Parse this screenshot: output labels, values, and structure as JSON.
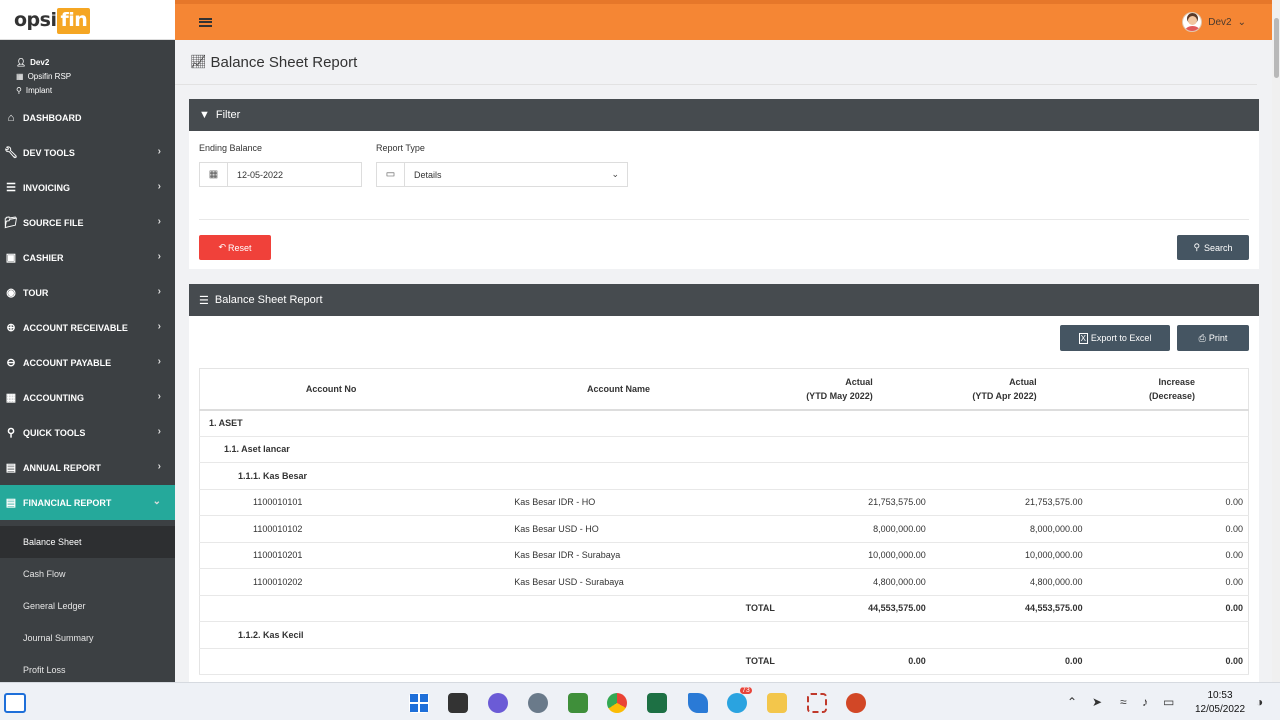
{
  "brand": {
    "logo_a": "opsi",
    "logo_b": "fin"
  },
  "header": {
    "user": "Dev2"
  },
  "user_info": {
    "name": "Dev2",
    "company": "Opsifin RSP",
    "location": "Implant"
  },
  "sidebar": {
    "items": [
      {
        "label": "DASHBOARD",
        "icon": "home-icon"
      },
      {
        "label": "DEV TOOLS",
        "icon": "wrench-icon"
      },
      {
        "label": "INVOICING",
        "icon": "list-icon"
      },
      {
        "label": "SOURCE FILE",
        "icon": "folder-icon"
      },
      {
        "label": "CASHIER",
        "icon": "money-icon"
      },
      {
        "label": "TOUR",
        "icon": "globe-icon"
      },
      {
        "label": "ACCOUNT RECEIVABLE",
        "icon": "plus-circle-icon"
      },
      {
        "label": "ACCOUNT PAYABLE",
        "icon": "minus-circle-icon"
      },
      {
        "label": "ACCOUNTING",
        "icon": "calculator-icon"
      },
      {
        "label": "QUICK TOOLS",
        "icon": "search-icon"
      },
      {
        "label": "ANNUAL REPORT",
        "icon": "document-icon"
      },
      {
        "label": "FINANCIAL REPORT",
        "icon": "document-icon"
      }
    ],
    "sub_items": [
      "Balance Sheet",
      "Cash Flow",
      "General Ledger",
      "Journal Summary",
      "Profit Loss"
    ]
  },
  "page": {
    "title": "Balance Sheet Report"
  },
  "filter": {
    "title": "Filter",
    "ending_balance_label": "Ending Balance",
    "ending_balance_value": "12-05-2022",
    "report_type_label": "Report Type",
    "report_type_value": "Details",
    "reset_label": "Reset",
    "search_label": "Search"
  },
  "report": {
    "title": "Balance Sheet Report",
    "export_label": "Export to Excel",
    "print_label": "Print",
    "columns": {
      "account_no": "Account No",
      "account_name": "Account Name",
      "actual_may_1": "Actual",
      "actual_may_2": "(YTD May 2022)",
      "actual_apr_1": "Actual",
      "actual_apr_2": "(YTD Apr 2022)",
      "increase_1": "Increase",
      "increase_2": "(Decrease)"
    },
    "rows": [
      {
        "type": "g1",
        "label": "1. ASET"
      },
      {
        "type": "g2",
        "label": "1.1. Aset lancar"
      },
      {
        "type": "g3",
        "label": "1.1.1. Kas Besar"
      },
      {
        "type": "d",
        "no": "1100010101",
        "name": "Kas Besar IDR - HO",
        "may": "21,753,575.00",
        "apr": "21,753,575.00",
        "inc": "0.00"
      },
      {
        "type": "d",
        "no": "1100010102",
        "name": "Kas Besar USD - HO",
        "may": "8,000,000.00",
        "apr": "8,000,000.00",
        "inc": "0.00"
      },
      {
        "type": "d",
        "no": "1100010201",
        "name": "Kas Besar IDR - Surabaya",
        "may": "10,000,000.00",
        "apr": "10,000,000.00",
        "inc": "0.00"
      },
      {
        "type": "d",
        "no": "1100010202",
        "name": "Kas Besar USD - Surabaya",
        "may": "4,800,000.00",
        "apr": "4,800,000.00",
        "inc": "0.00"
      },
      {
        "type": "t",
        "label": "TOTAL",
        "may": "44,553,575.00",
        "apr": "44,553,575.00",
        "inc": "0.00"
      },
      {
        "type": "g3",
        "label": "1.1.2. Kas Kecil"
      },
      {
        "type": "t",
        "label": "TOTAL",
        "may": "0.00",
        "apr": "0.00",
        "inc": "0.00"
      }
    ]
  },
  "taskbar": {
    "time": "10:53",
    "date": "12/05/2022",
    "badge": "73"
  },
  "colors": {
    "topbar": "#f58634",
    "sidebar": "#3c4043",
    "active": "#25a99b",
    "reset": "#f0413a",
    "dark_button": "#455562",
    "panel_head": "#464b4f"
  }
}
